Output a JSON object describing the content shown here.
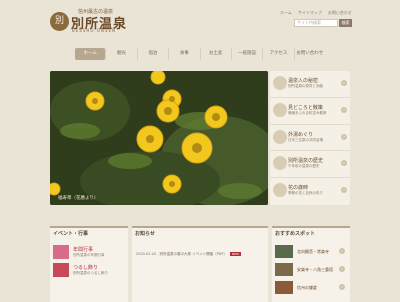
{
  "header": {
    "tagline": "信州最古の温泉",
    "logo_char": "別",
    "title": "別所温泉",
    "subtitle": "BESSHO ONSEN",
    "links": [
      "ホーム",
      "サイトマップ",
      "お問い合わせ"
    ],
    "search_placeholder": "サイト内検索",
    "search_button": "検索"
  },
  "nav": {
    "items": [
      "ホーム",
      "観光",
      "宿泊",
      "食事",
      "お土産",
      "一般施設",
      "アクセス",
      "お問い合わせ"
    ]
  },
  "hero": {
    "caption": "福寿草（花暦より）"
  },
  "side_menu": [
    {
      "title": "温泉入の秘密",
      "desc": "別所温泉の泉質と効能"
    },
    {
      "title": "見どころと散策",
      "desc": "情緒あふれる町並み散策"
    },
    {
      "title": "外湯めぐり",
      "desc": "日本三名泉の共同浴場"
    },
    {
      "title": "別所温泉の歴史",
      "desc": "千年前の温泉の歴史"
    },
    {
      "title": "花の歳時",
      "desc": "季節の花と自然の彩り"
    }
  ],
  "events": {
    "heading": "イベント・行事",
    "items": [
      {
        "title": "年間行事",
        "desc": "別所温泉の年間行事"
      },
      {
        "title": "つるし飾り",
        "desc": "別所温泉のつるし飾り"
      }
    ]
  },
  "news": {
    "heading": "お知らせ",
    "line": "2020.02.20 - 別所温泉の春の大祭 イベント開催（PDF）",
    "badge": "NEW"
  },
  "spots": {
    "heading": "おすすめスポット",
    "items": [
      "北向観音・常楽寺",
      "安楽寺・八角三重塔",
      "信州の鎌倉"
    ]
  },
  "colors": {
    "accent": "#b6a78f",
    "brand": "#6b4a2a",
    "new": "#b0303a"
  }
}
